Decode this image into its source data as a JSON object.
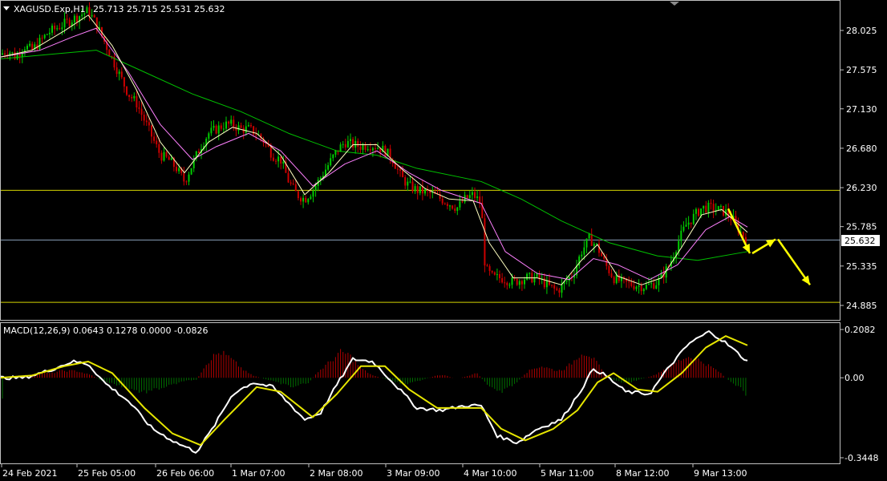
{
  "header": {
    "symbol_info": "XAGUSD.Exp,H1",
    "ohlc": "25.713 25.715 25.531 25.632"
  },
  "macd_header": "MACD(12,26,9) 0.0643 0.1278 0.0000 -0.0826",
  "current_price_label": "25.632",
  "colors": {
    "background": "#000000",
    "bull_candle": "#00cc00",
    "bear_candle": "#cc0000",
    "ma_fast": "#ffffc0",
    "ma_mid": "#ff80ff",
    "ma_slow": "#00c000",
    "support_line": "#d4d400",
    "price_line": "#8aa0b8",
    "macd_line": "#ffffff",
    "signal_line": "#e6e600",
    "hist_pos": "#b00000",
    "hist_neg": "#007000",
    "arrow": "#ffff00"
  },
  "chart_data": [
    {
      "type": "candlestick",
      "title": "XAGUSD.Exp,H1",
      "y_ticks": [
        "28.025",
        "27.575",
        "27.130",
        "26.680",
        "26.230",
        "25.785",
        "25.335",
        "24.885"
      ],
      "ylim": [
        24.8,
        28.4
      ],
      "x_ticks": [
        "24 Feb 2021",
        "25 Feb 05:00",
        "26 Feb 06:00",
        "1 Mar 07:00",
        "2 Mar 08:00",
        "3 Mar 09:00",
        "4 Mar 10:00",
        "5 Mar 11:00",
        "8 Mar 12:00",
        "9 Mar 13:00"
      ],
      "close_path": [
        [
          0,
          27.75
        ],
        [
          10,
          27.8
        ],
        [
          20,
          27.72
        ],
        [
          30,
          27.85
        ],
        [
          40,
          27.8
        ],
        [
          50,
          27.9
        ],
        [
          60,
          28.0
        ],
        [
          70,
          28.05
        ],
        [
          80,
          28.1
        ],
        [
          90,
          28.15
        ],
        [
          100,
          28.2
        ],
        [
          110,
          28.25
        ],
        [
          120,
          28.1
        ],
        [
          130,
          27.9
        ],
        [
          140,
          27.7
        ],
        [
          150,
          27.5
        ],
        [
          160,
          27.3
        ],
        [
          170,
          27.2
        ],
        [
          180,
          27.0
        ],
        [
          190,
          26.8
        ],
        [
          200,
          26.6
        ],
        [
          210,
          26.55
        ],
        [
          220,
          26.45
        ],
        [
          230,
          26.3
        ],
        [
          240,
          26.5
        ],
        [
          250,
          26.7
        ],
        [
          260,
          26.85
        ],
        [
          270,
          26.9
        ],
        [
          280,
          26.95
        ],
        [
          290,
          26.95
        ],
        [
          300,
          26.9
        ],
        [
          310,
          26.9
        ],
        [
          320,
          26.85
        ],
        [
          330,
          26.75
        ],
        [
          340,
          26.6
        ],
        [
          350,
          26.55
        ],
        [
          360,
          26.3
        ],
        [
          370,
          26.15
        ],
        [
          380,
          26.1
        ],
        [
          390,
          26.2
        ],
        [
          400,
          26.35
        ],
        [
          410,
          26.5
        ],
        [
          420,
          26.65
        ],
        [
          430,
          26.75
        ],
        [
          440,
          26.72
        ],
        [
          450,
          26.7
        ],
        [
          460,
          26.72
        ],
        [
          470,
          26.7
        ],
        [
          480,
          26.65
        ],
        [
          490,
          26.55
        ],
        [
          500,
          26.35
        ],
        [
          510,
          26.25
        ],
        [
          520,
          26.2
        ],
        [
          530,
          26.18
        ],
        [
          540,
          26.15
        ],
        [
          550,
          26.1
        ],
        [
          560,
          26.05
        ],
        [
          570,
          26.0
        ],
        [
          580,
          26.1
        ],
        [
          590,
          26.15
        ],
        [
          600,
          26.05
        ],
        [
          605,
          25.3
        ],
        [
          615,
          25.2
        ],
        [
          625,
          25.2
        ],
        [
          640,
          25.15
        ],
        [
          655,
          25.2
        ],
        [
          670,
          25.2
        ],
        [
          685,
          25.1
        ],
        [
          695,
          25.05
        ],
        [
          705,
          25.15
        ],
        [
          715,
          25.25
        ],
        [
          725,
          25.5
        ],
        [
          735,
          25.65
        ],
        [
          745,
          25.55
        ],
        [
          755,
          25.35
        ],
        [
          765,
          25.2
        ],
        [
          775,
          25.15
        ],
        [
          790,
          25.12
        ],
        [
          805,
          25.1
        ],
        [
          820,
          25.15
        ],
        [
          835,
          25.35
        ],
        [
          845,
          25.6
        ],
        [
          855,
          25.8
        ],
        [
          865,
          25.9
        ],
        [
          875,
          26.0
        ],
        [
          885,
          26.0
        ],
        [
          895,
          25.98
        ],
        [
          905,
          25.95
        ],
        [
          915,
          25.85
        ],
        [
          925,
          25.7
        ],
        [
          932,
          25.63
        ]
      ],
      "ma_fast_path": [
        [
          0,
          27.72
        ],
        [
          40,
          27.8
        ],
        [
          80,
          28.02
        ],
        [
          110,
          28.2
        ],
        [
          140,
          27.85
        ],
        [
          170,
          27.35
        ],
        [
          200,
          26.75
        ],
        [
          230,
          26.4
        ],
        [
          260,
          26.75
        ],
        [
          290,
          26.92
        ],
        [
          320,
          26.85
        ],
        [
          350,
          26.6
        ],
        [
          380,
          26.15
        ],
        [
          410,
          26.4
        ],
        [
          440,
          26.72
        ],
        [
          470,
          26.72
        ],
        [
          500,
          26.45
        ],
        [
          530,
          26.22
        ],
        [
          560,
          26.1
        ],
        [
          590,
          26.08
        ],
        [
          610,
          25.6
        ],
        [
          640,
          25.2
        ],
        [
          670,
          25.2
        ],
        [
          700,
          25.12
        ],
        [
          725,
          25.4
        ],
        [
          745,
          25.58
        ],
        [
          770,
          25.22
        ],
        [
          800,
          25.12
        ],
        [
          825,
          25.2
        ],
        [
          850,
          25.55
        ],
        [
          875,
          25.92
        ],
        [
          900,
          25.98
        ],
        [
          932,
          25.72
        ]
      ],
      "ma_mid_path": [
        [
          0,
          27.72
        ],
        [
          50,
          27.8
        ],
        [
          90,
          27.95
        ],
        [
          120,
          28.05
        ],
        [
          160,
          27.55
        ],
        [
          200,
          26.95
        ],
        [
          240,
          26.55
        ],
        [
          270,
          26.7
        ],
        [
          310,
          26.85
        ],
        [
          350,
          26.65
        ],
        [
          390,
          26.25
        ],
        [
          430,
          26.5
        ],
        [
          470,
          26.65
        ],
        [
          510,
          26.4
        ],
        [
          550,
          26.2
        ],
        [
          600,
          26.05
        ],
        [
          630,
          25.5
        ],
        [
          670,
          25.25
        ],
        [
          710,
          25.18
        ],
        [
          740,
          25.42
        ],
        [
          770,
          25.35
        ],
        [
          810,
          25.18
        ],
        [
          845,
          25.35
        ],
        [
          880,
          25.75
        ],
        [
          910,
          25.9
        ],
        [
          932,
          25.78
        ]
      ],
      "ma_slow_path": [
        [
          0,
          27.7
        ],
        [
          60,
          27.75
        ],
        [
          120,
          27.8
        ],
        [
          180,
          27.55
        ],
        [
          240,
          27.3
        ],
        [
          300,
          27.1
        ],
        [
          360,
          26.85
        ],
        [
          420,
          26.65
        ],
        [
          470,
          26.6
        ],
        [
          520,
          26.45
        ],
        [
          600,
          26.3
        ],
        [
          650,
          26.1
        ],
        [
          700,
          25.85
        ],
        [
          760,
          25.6
        ],
        [
          820,
          25.45
        ],
        [
          870,
          25.4
        ],
        [
          932,
          25.5
        ]
      ],
      "horizontal_levels": [
        26.2,
        25.632,
        24.92
      ],
      "forecast_arrows": [
        [
          [
            908,
            25.99
          ],
          [
            935,
            25.48
          ]
        ],
        [
          [
            938,
            25.48
          ],
          [
            967,
            25.64
          ]
        ],
        [
          [
            970,
            25.64
          ],
          [
            1010,
            25.12
          ]
        ]
      ],
      "grid": false
    },
    {
      "type": "macd",
      "title": "MACD(12,26,9)",
      "y_ticks": [
        "0.2082",
        "0.00",
        "-0.3448"
      ],
      "ylim": [
        -0.3448,
        0.2082
      ],
      "histogram": [
        [
          5,
          0.0
        ],
        [
          15,
          0.0
        ],
        [
          25,
          0.0
        ],
        [
          35,
          0.01
        ],
        [
          45,
          0.02
        ],
        [
          55,
          0.02
        ],
        [
          65,
          0.02
        ],
        [
          75,
          0.03
        ],
        [
          85,
          0.03
        ],
        [
          95,
          0.03
        ],
        [
          105,
          0.02
        ],
        [
          115,
          0.01
        ],
        [
          125,
          -0.01
        ],
        [
          135,
          -0.02
        ],
        [
          145,
          -0.03
        ],
        [
          155,
          -0.04
        ],
        [
          165,
          -0.05
        ],
        [
          175,
          -0.06
        ],
        [
          185,
          -0.06
        ],
        [
          195,
          -0.05
        ],
        [
          205,
          -0.04
        ],
        [
          215,
          -0.03
        ],
        [
          225,
          -0.02
        ],
        [
          235,
          -0.01
        ],
        [
          245,
          -0.01
        ],
        [
          255,
          0.05
        ],
        [
          265,
          0.09
        ],
        [
          275,
          0.11
        ],
        [
          285,
          0.09
        ],
        [
          295,
          0.06
        ],
        [
          305,
          0.03
        ],
        [
          315,
          0.01
        ],
        [
          325,
          0.0
        ],
        [
          335,
          -0.01
        ],
        [
          345,
          -0.02
        ],
        [
          355,
          -0.03
        ],
        [
          365,
          -0.04
        ],
        [
          375,
          -0.03
        ],
        [
          385,
          -0.02
        ],
        [
          395,
          0.02
        ],
        [
          405,
          0.05
        ],
        [
          415,
          0.08
        ],
        [
          425,
          0.11
        ],
        [
          435,
          0.1
        ],
        [
          445,
          0.06
        ],
        [
          455,
          0.03
        ],
        [
          465,
          0.01
        ],
        [
          475,
          0.0
        ],
        [
          485,
          -0.01
        ],
        [
          495,
          -0.02
        ],
        [
          505,
          -0.03
        ],
        [
          515,
          -0.02
        ],
        [
          525,
          -0.01
        ],
        [
          535,
          0.0
        ],
        [
          545,
          0.01
        ],
        [
          555,
          0.01
        ],
        [
          565,
          0.0
        ],
        [
          575,
          0.0
        ],
        [
          585,
          0.01
        ],
        [
          595,
          0.02
        ],
        [
          605,
          -0.02
        ],
        [
          615,
          -0.05
        ],
        [
          625,
          -0.06
        ],
        [
          635,
          -0.04
        ],
        [
          645,
          -0.02
        ],
        [
          655,
          0.02
        ],
        [
          665,
          0.04
        ],
        [
          675,
          0.05
        ],
        [
          685,
          0.04
        ],
        [
          695,
          0.03
        ],
        [
          705,
          0.04
        ],
        [
          715,
          0.07
        ],
        [
          725,
          0.11
        ],
        [
          735,
          0.1
        ],
        [
          745,
          0.06
        ],
        [
          755,
          0.01
        ],
        [
          765,
          -0.01
        ],
        [
          775,
          -0.02
        ],
        [
          785,
          -0.02
        ],
        [
          795,
          -0.01
        ],
        [
          805,
          0.0
        ],
        [
          815,
          0.01
        ],
        [
          825,
          0.03
        ],
        [
          835,
          0.05
        ],
        [
          845,
          0.07
        ],
        [
          855,
          0.09
        ],
        [
          865,
          0.09
        ],
        [
          875,
          0.07
        ],
        [
          885,
          0.05
        ],
        [
          895,
          0.03
        ],
        [
          905,
          0.0
        ],
        [
          915,
          -0.03
        ],
        [
          925,
          -0.05
        ],
        [
          932,
          -0.08
        ]
      ],
      "macd_line": [
        [
          0,
          0.0
        ],
        [
          30,
          0.0
        ],
        [
          60,
          0.03
        ],
        [
          90,
          0.07
        ],
        [
          110,
          0.06
        ],
        [
          130,
          -0.02
        ],
        [
          160,
          -0.1
        ],
        [
          190,
          -0.22
        ],
        [
          220,
          -0.28
        ],
        [
          245,
          -0.32
        ],
        [
          265,
          -0.22
        ],
        [
          290,
          -0.07
        ],
        [
          315,
          -0.02
        ],
        [
          340,
          -0.04
        ],
        [
          360,
          -0.11
        ],
        [
          380,
          -0.18
        ],
        [
          400,
          -0.15
        ],
        [
          420,
          -0.03
        ],
        [
          440,
          0.08
        ],
        [
          465,
          0.07
        ],
        [
          490,
          -0.02
        ],
        [
          520,
          -0.13
        ],
        [
          550,
          -0.14
        ],
        [
          580,
          -0.12
        ],
        [
          600,
          -0.12
        ],
        [
          620,
          -0.25
        ],
        [
          645,
          -0.28
        ],
        [
          670,
          -0.22
        ],
        [
          700,
          -0.18
        ],
        [
          725,
          -0.05
        ],
        [
          740,
          0.04
        ],
        [
          755,
          0.01
        ],
        [
          780,
          -0.06
        ],
        [
          810,
          -0.07
        ],
        [
          835,
          0.05
        ],
        [
          860,
          0.15
        ],
        [
          885,
          0.2
        ],
        [
          905,
          0.15
        ],
        [
          932,
          0.07
        ]
      ],
      "signal_line": [
        [
          0,
          0.0
        ],
        [
          40,
          0.01
        ],
        [
          80,
          0.05
        ],
        [
          110,
          0.07
        ],
        [
          140,
          0.02
        ],
        [
          180,
          -0.13
        ],
        [
          215,
          -0.24
        ],
        [
          250,
          -0.29
        ],
        [
          280,
          -0.18
        ],
        [
          320,
          -0.04
        ],
        [
          350,
          -0.06
        ],
        [
          390,
          -0.17
        ],
        [
          420,
          -0.07
        ],
        [
          450,
          0.05
        ],
        [
          480,
          0.05
        ],
        [
          510,
          -0.05
        ],
        [
          545,
          -0.13
        ],
        [
          600,
          -0.13
        ],
        [
          625,
          -0.22
        ],
        [
          655,
          -0.27
        ],
        [
          690,
          -0.22
        ],
        [
          720,
          -0.14
        ],
        [
          745,
          -0.02
        ],
        [
          765,
          0.02
        ],
        [
          795,
          -0.05
        ],
        [
          820,
          -0.06
        ],
        [
          850,
          0.02
        ],
        [
          880,
          0.13
        ],
        [
          905,
          0.18
        ],
        [
          932,
          0.14
        ]
      ]
    }
  ]
}
